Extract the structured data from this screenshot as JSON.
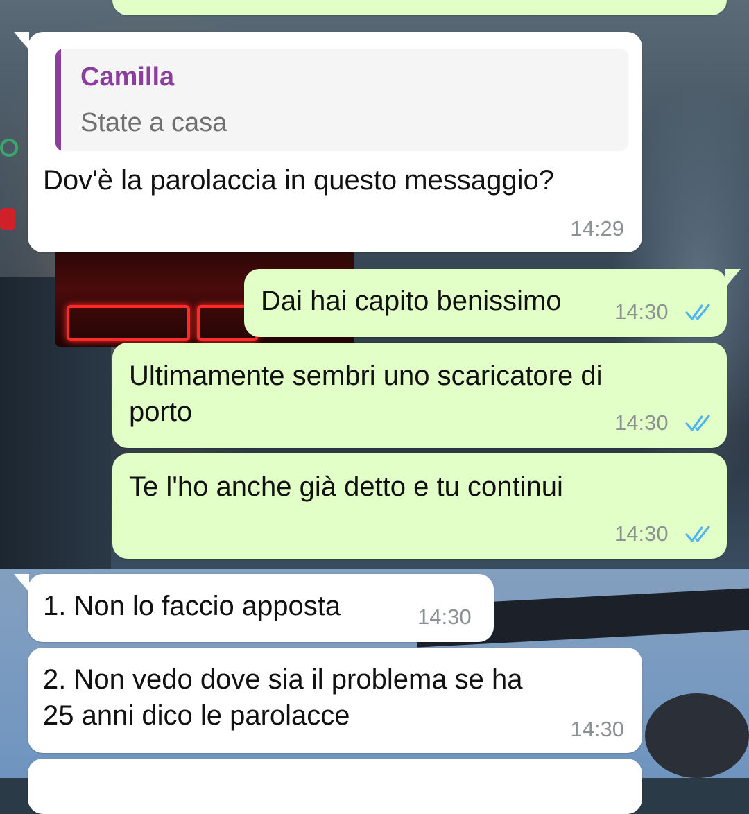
{
  "conversation": {
    "top_partial": {
      "type": "outgoing"
    },
    "m1": {
      "reply": {
        "name": "Camilla",
        "text": "State a casa"
      },
      "text": "Dov'è la parolaccia in questo messaggio?",
      "time": "14:29"
    },
    "m2": {
      "text": "Dai hai capito benissimo",
      "time": "14:30",
      "status": "read"
    },
    "m3": {
      "line1": "Ultimamente sembri uno scaricatore di",
      "line2": "porto",
      "time": "14:30",
      "status": "read"
    },
    "m4": {
      "text": "Te l'ho anche già detto e tu continui",
      "time": "14:30",
      "status": "read"
    },
    "m5": {
      "text": "1. Non lo faccio apposta",
      "time": "14:30"
    },
    "m6": {
      "line1": "2. Non vedo dove sia il problema se ha",
      "line2": "25 anni dico le parolacce",
      "time": "14:30"
    }
  },
  "colors": {
    "incoming_bubble": "#ffffff",
    "outgoing_bubble": "#e2ffc8",
    "reply_accent": "#8a3f9c",
    "read_ticks": "#4fb6ec",
    "timestamp": "#8c9294"
  },
  "icons": {
    "read_receipt": "double-check-icon"
  }
}
